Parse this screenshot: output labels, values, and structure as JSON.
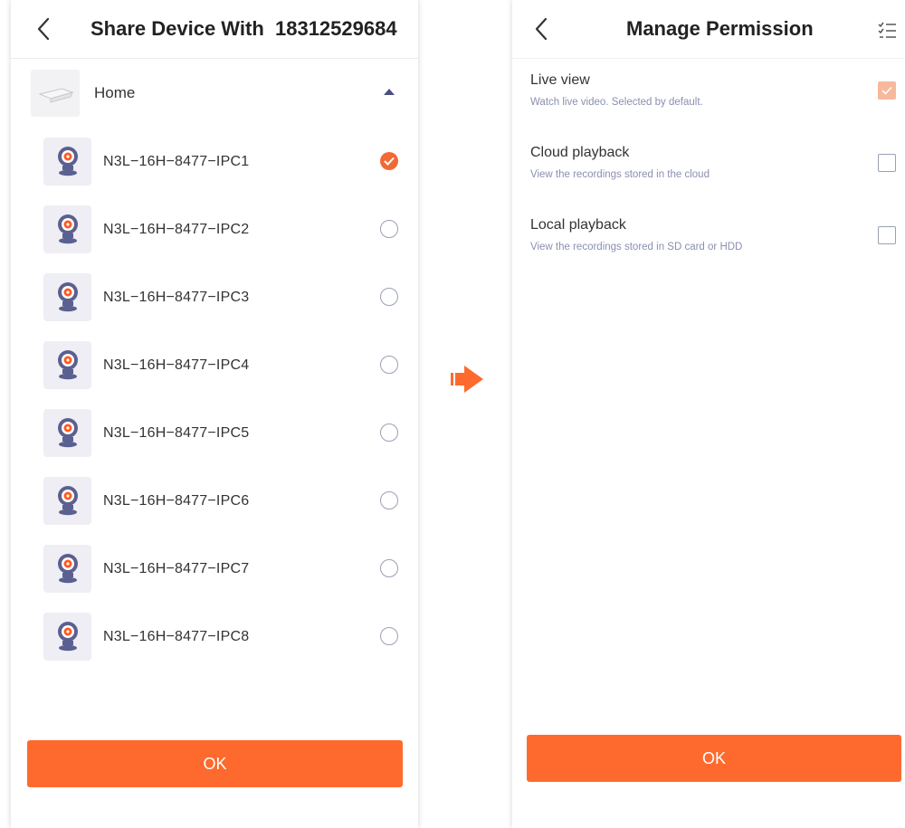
{
  "left": {
    "title": "Share Device With  18312529684",
    "group": {
      "label": "Home"
    },
    "devices": [
      {
        "name": "N3L−16H−8477−IPC1",
        "selected": true
      },
      {
        "name": "N3L−16H−8477−IPC2",
        "selected": false
      },
      {
        "name": "N3L−16H−8477−IPC3",
        "selected": false
      },
      {
        "name": "N3L−16H−8477−IPC4",
        "selected": false
      },
      {
        "name": "N3L−16H−8477−IPC5",
        "selected": false
      },
      {
        "name": "N3L−16H−8477−IPC6",
        "selected": false
      },
      {
        "name": "N3L−16H−8477−IPC7",
        "selected": false
      },
      {
        "name": "N3L−16H−8477−IPC8",
        "selected": false
      }
    ],
    "ok_label": "OK"
  },
  "right": {
    "title": "Manage Permission",
    "permissions": [
      {
        "title": "Live view",
        "desc": "Watch live video. Selected by default.",
        "checked": true
      },
      {
        "title": "Cloud playback",
        "desc": "View the recordings stored in the cloud",
        "checked": false
      },
      {
        "title": "Local playback",
        "desc": "View the recordings stored in SD card or HDD",
        "checked": false
      }
    ],
    "ok_label": "OK"
  },
  "icons": {
    "back": "chevron-left-icon",
    "group_expand": "caret-up-icon",
    "device": "camera-icon",
    "select_all": "checklist-icon",
    "flow": "arrow-right-icon"
  },
  "colors": {
    "accent": "#fe6a2e",
    "checked_radio": "#f26a33",
    "checked_disabled": "#f7b89c",
    "outline": "#9aa0b4",
    "icon_dark": "#4a5080"
  }
}
